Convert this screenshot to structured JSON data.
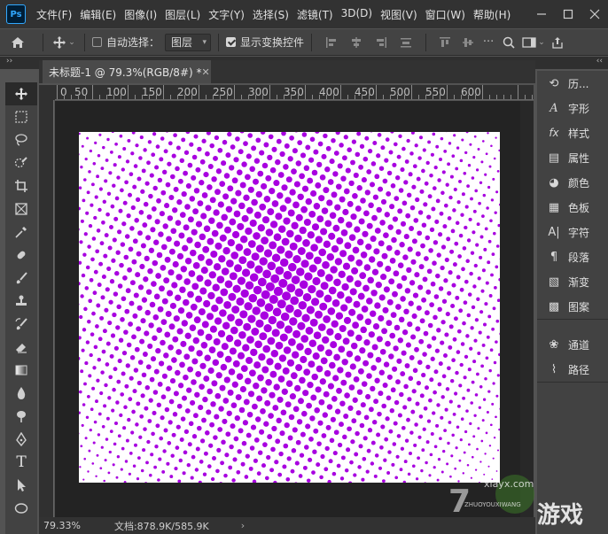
{
  "app": {
    "logo": "Ps",
    "menu": [
      "文件(F)",
      "编辑(E)",
      "图像(I)",
      "图层(L)",
      "文字(Y)",
      "选择(S)",
      "滤镜(T)",
      "3D(D)",
      "视图(V)",
      "窗口(W)",
      "帮助(H)"
    ]
  },
  "options": {
    "auto_select_label": "自动选择：",
    "layer_dropdown": "图层",
    "show_transform_label": "显示变换控件"
  },
  "document": {
    "tab_title": "未标题-1 @ 79.3%(RGB/8#) *",
    "zoom": "79.33%",
    "doc_size": "文档:878.9K/585.9K"
  },
  "ruler": [
    "0",
    "50",
    "100",
    "150",
    "200",
    "250",
    "300",
    "350",
    "400",
    "450",
    "500",
    "550",
    "600"
  ],
  "dock": [
    {
      "icon": "history-icon",
      "label": "历..."
    },
    {
      "icon": "glyphs-icon",
      "label": "字形"
    },
    {
      "icon": "styles-icon",
      "label": "样式"
    },
    {
      "icon": "properties-icon",
      "label": "属性"
    },
    {
      "icon": "color-icon",
      "label": "颜色"
    },
    {
      "icon": "swatches-icon",
      "label": "色板"
    },
    {
      "icon": "character-icon",
      "label": "字符"
    },
    {
      "icon": "paragraph-icon",
      "label": "段落"
    },
    {
      "icon": "gradient-icon",
      "label": "渐变"
    },
    {
      "icon": "patterns-icon",
      "label": "图案"
    },
    {
      "icon": "channels-icon",
      "label": "通道"
    },
    {
      "icon": "paths-icon",
      "label": "路径"
    }
  ],
  "colors": {
    "halftone": "#a800e0",
    "canvas_bg": "#ffffff"
  },
  "watermark": {
    "brand": "xiayx.com",
    "sub": "ZHUOYOUXIWANG",
    "text": "游戏"
  }
}
